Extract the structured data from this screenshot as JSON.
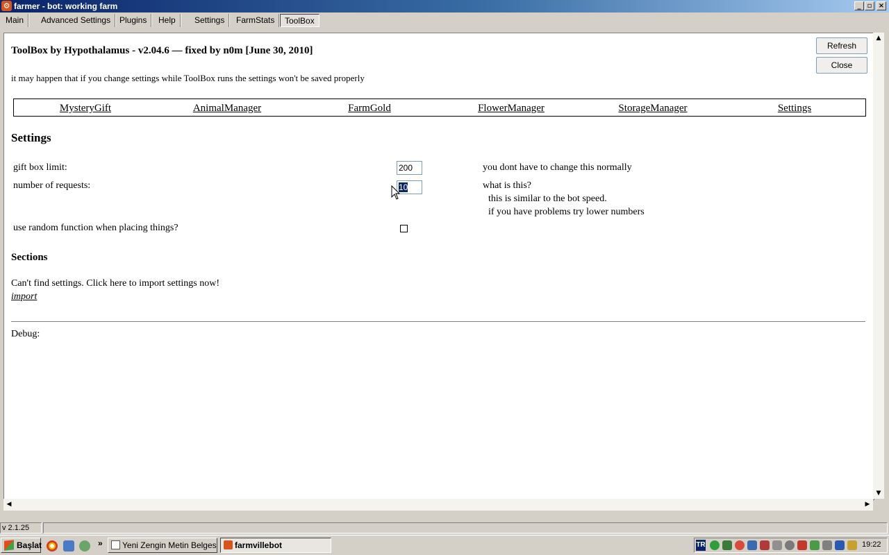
{
  "window": {
    "title": "farmer - bot: working farm",
    "app_icon": "farmer-icon",
    "controls": [
      "minimize",
      "maximize",
      "close"
    ]
  },
  "tabs": [
    {
      "label": "Main"
    },
    {
      "label": "Advanced Settings"
    },
    {
      "label": "Plugins"
    },
    {
      "label": "Help"
    },
    {
      "label": "Settings"
    },
    {
      "label": "FarmStats"
    },
    {
      "label": "ToolBox",
      "active": true
    }
  ],
  "toolbox": {
    "heading": "ToolBox by Hypothalamus - v2.04.6 — fixed by n0m [June 30, 2010]",
    "warning": "it may happen that if you change settings while ToolBox runs the settings won't be saved properly",
    "refresh_label": "Refresh",
    "close_label": "Close",
    "nav": [
      "MysteryGift",
      "AnimalManager",
      "FarmGold",
      "FlowerManager",
      "StorageManager",
      "Settings"
    ],
    "settings_heading": "Settings",
    "gift_label": "gift box limit:",
    "gift_value": "200",
    "gift_hint": "you dont have to change this normally",
    "requests_label": "number of requests:",
    "requests_value": "10",
    "requests_hint_q": "what is this?",
    "requests_hint_1": "this is similar to the bot speed.",
    "requests_hint_2": "if you have problems try lower numbers",
    "random_label": "use random function when placing things?",
    "random_checked": false,
    "sections_heading": "Sections",
    "sections_text": "Can't find settings. Click here to import settings now!",
    "import_label": "import",
    "debug_label": "Debug:"
  },
  "status": {
    "version": "v 2.1.25"
  },
  "taskbar": {
    "start_label": "Başlat",
    "chevron": "»",
    "tasks": [
      {
        "label": "Yeni Zengin Metin Belgesi...",
        "icon": "document-icon"
      },
      {
        "label": "farmvillebot",
        "icon": "farmer-icon",
        "active": true
      }
    ],
    "language": "TR",
    "clock": "19:22"
  }
}
